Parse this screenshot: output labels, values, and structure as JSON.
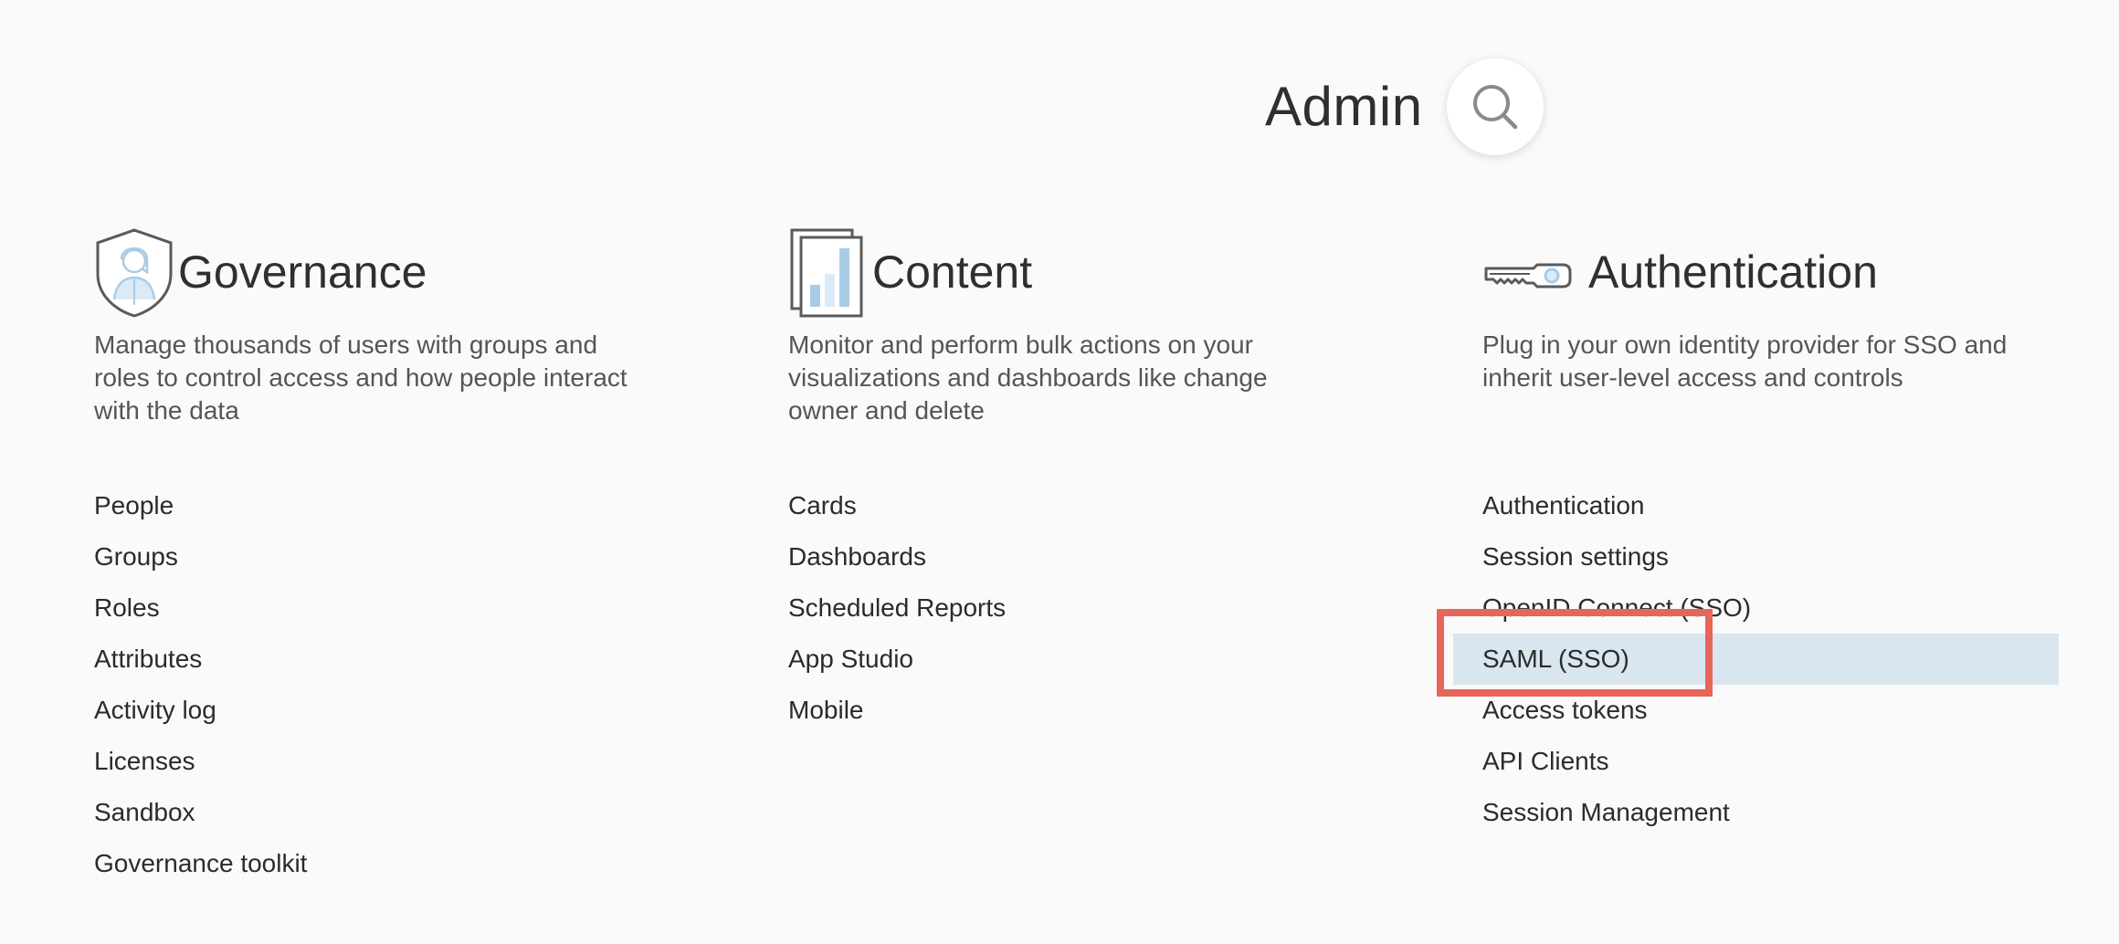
{
  "header": {
    "title": "Admin",
    "search_icon": "search-icon"
  },
  "colors": {
    "accent_blue": "#a9cce6",
    "selection_bg": "#d9e6ef",
    "annotation_red": "#e8655a",
    "text_dark": "#2b2b2b",
    "text_muted": "#555555"
  },
  "columns": [
    {
      "title": "Governance",
      "icon": "shield-user-icon",
      "description": "Manage thousands of users with groups and roles to control access and how people interact with the data",
      "links": [
        "People",
        "Groups",
        "Roles",
        "Attributes",
        "Activity log",
        "Licenses",
        "Sandbox",
        "Governance toolkit"
      ]
    },
    {
      "title": "Content",
      "icon": "chart-pages-icon",
      "description": "Monitor and perform bulk actions on your visualizations and dashboards like change owner and delete",
      "links": [
        "Cards",
        "Dashboards",
        "Scheduled Reports",
        "App Studio",
        "Mobile"
      ]
    },
    {
      "title": "Authentication",
      "icon": "key-icon",
      "description": "Plug in your own identity provider for SSO and inherit user-level access and controls",
      "links": [
        "Authentication",
        "Session settings",
        "OpenID Connect (SSO)",
        "SAML (SSO)",
        "Access tokens",
        "API Clients",
        "Session Management"
      ],
      "selected_link": "SAML (SSO)"
    }
  ]
}
